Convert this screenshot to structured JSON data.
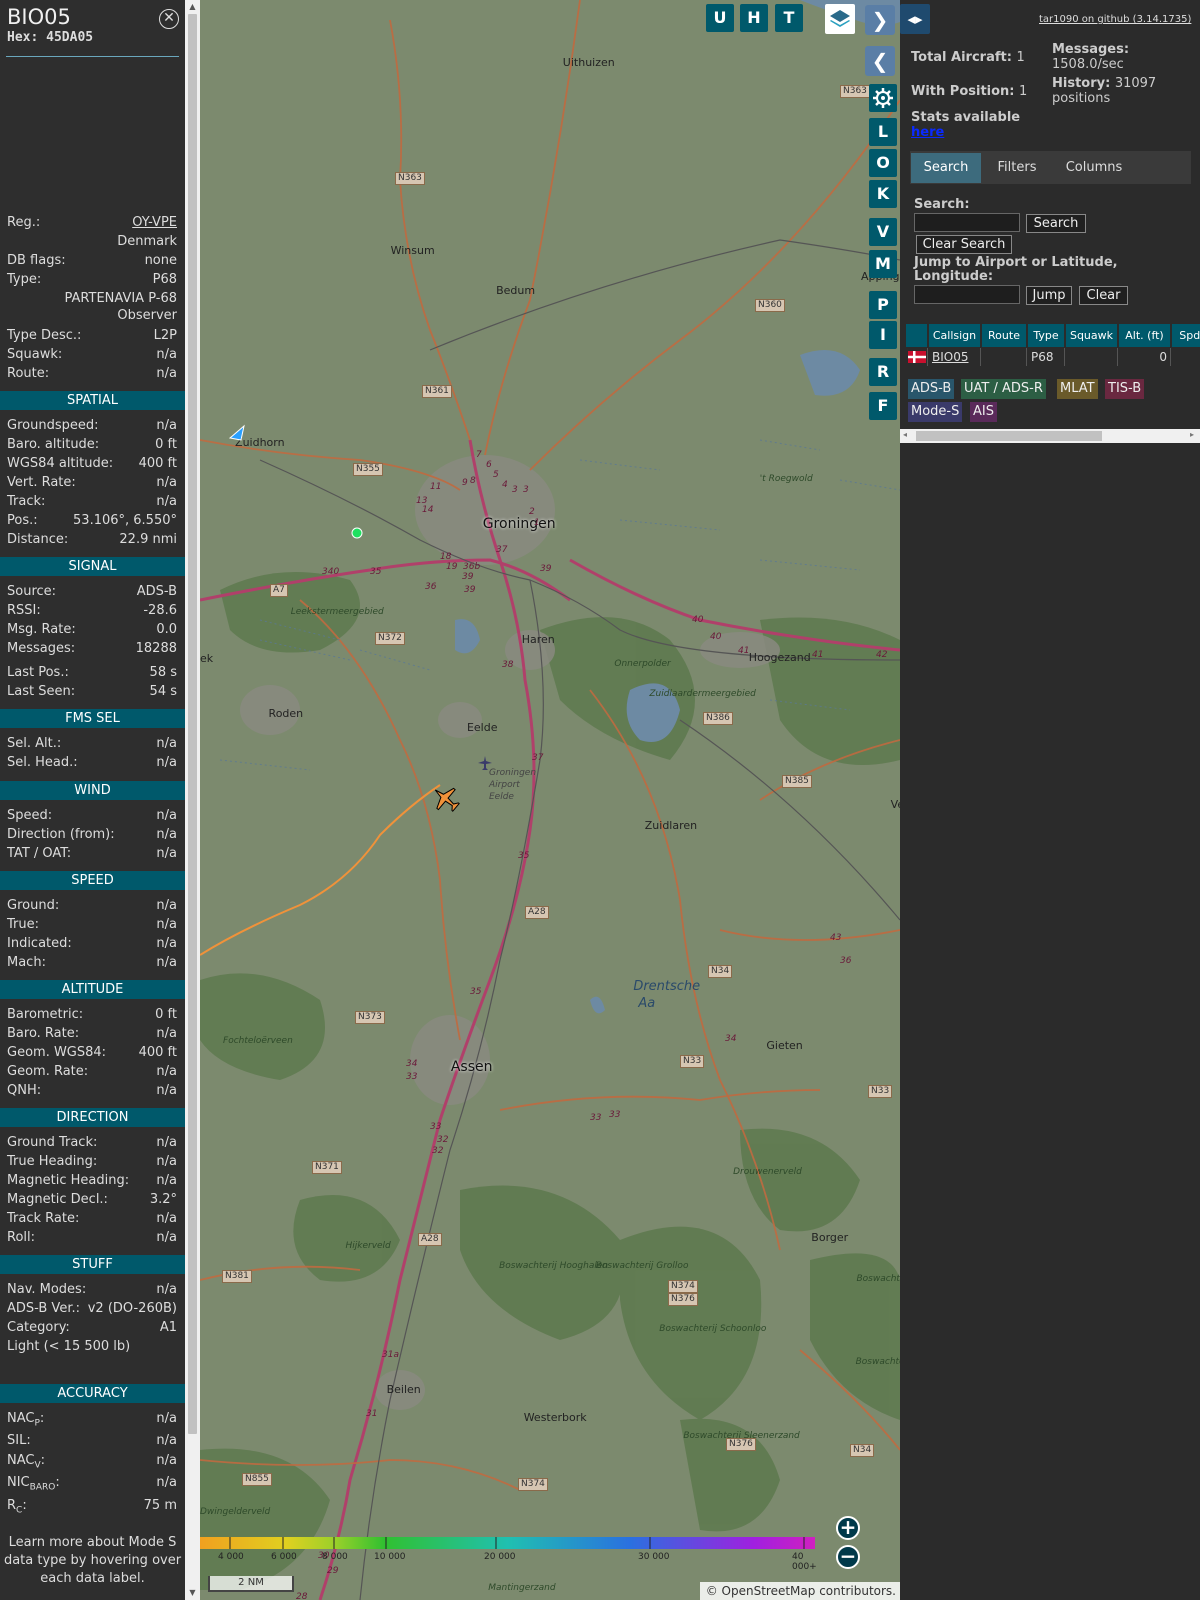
{
  "infoblock": {
    "callsign": "BIO05",
    "hex_label": "Hex:",
    "hex": "45DA05",
    "close_icon": "close-circle-icon",
    "rows_top": [
      {
        "k": "Reg.:",
        "v": "OY-VPE",
        "link": true
      },
      {
        "k": "",
        "v": "Denmark"
      },
      {
        "k": "DB flags:",
        "v": "none"
      },
      {
        "k": "Type:",
        "v": "P68"
      },
      {
        "k": "",
        "v": "PARTENAVIA P-68 Observer"
      },
      {
        "k": "Type Desc.:",
        "v": "L2P"
      },
      {
        "k": "Squawk:",
        "v": "n/a"
      },
      {
        "k": "Route:",
        "v": "n/a"
      }
    ],
    "spatial": {
      "title": "SPATIAL",
      "rows": [
        {
          "k": "Groundspeed:",
          "v": "n/a"
        },
        {
          "k": "Baro. altitude:",
          "v": "0 ft"
        },
        {
          "k": "WGS84 altitude:",
          "v": "400 ft"
        },
        {
          "k": "Vert. Rate:",
          "v": "n/a"
        },
        {
          "k": "Track:",
          "v": "n/a"
        },
        {
          "k": "Pos.:",
          "v": "53.106°, 6.550°"
        },
        {
          "k": "Distance:",
          "v": "22.9 nmi"
        }
      ]
    },
    "signal": {
      "title": "SIGNAL",
      "rows": [
        {
          "k": "Source:",
          "v": "ADS-B"
        },
        {
          "k": "RSSI:",
          "v": "-28.6"
        },
        {
          "k": "Msg. Rate:",
          "v": "0.0"
        },
        {
          "k": "Messages:",
          "v": "18288"
        },
        {
          "k": "Last Pos.:",
          "v": "58 s"
        },
        {
          "k": "Last Seen:",
          "v": "54 s"
        }
      ]
    },
    "fms": {
      "title": "FMS SEL",
      "rows": [
        {
          "k": "Sel. Alt.:",
          "v": "n/a"
        },
        {
          "k": "Sel. Head.:",
          "v": "n/a"
        }
      ]
    },
    "wind": {
      "title": "WIND",
      "rows": [
        {
          "k": "Speed:",
          "v": "n/a"
        },
        {
          "k": "Direction (from):",
          "v": "n/a"
        },
        {
          "k": "TAT / OAT:",
          "v": "n/a"
        }
      ]
    },
    "speed": {
      "title": "SPEED",
      "rows": [
        {
          "k": "Ground:",
          "v": "n/a"
        },
        {
          "k": "True:",
          "v": "n/a"
        },
        {
          "k": "Indicated:",
          "v": "n/a"
        },
        {
          "k": "Mach:",
          "v": "n/a"
        }
      ]
    },
    "altitude": {
      "title": "ALTITUDE",
      "rows": [
        {
          "k": "Barometric:",
          "v": "0 ft"
        },
        {
          "k": "Baro. Rate:",
          "v": "n/a"
        },
        {
          "k": "Geom. WGS84:",
          "v": "400 ft"
        },
        {
          "k": "Geom. Rate:",
          "v": "n/a"
        },
        {
          "k": "QNH:",
          "v": "n/a"
        }
      ]
    },
    "direction": {
      "title": "DIRECTION",
      "rows": [
        {
          "k": "Ground Track:",
          "v": "n/a"
        },
        {
          "k": "True Heading:",
          "v": "n/a"
        },
        {
          "k": "Magnetic Heading:",
          "v": "n/a"
        },
        {
          "k": "Magnetic Decl.:",
          "v": "3.2°"
        },
        {
          "k": "Track Rate:",
          "v": "n/a"
        },
        {
          "k": "Roll:",
          "v": "n/a"
        }
      ]
    },
    "stuff": {
      "title": "STUFF",
      "rows": [
        {
          "k": "Nav. Modes:",
          "v": "n/a"
        },
        {
          "k": "ADS-B Ver.:",
          "v": "v2 (DO-260B)"
        },
        {
          "k": "Category:",
          "v": "A1"
        },
        {
          "k": "Light (< 15 500 lb)",
          "v": ""
        }
      ]
    },
    "accuracy": {
      "title": "ACCURACY",
      "rows": [
        {
          "k": "NAC",
          "sub": "P",
          "v": "n/a"
        },
        {
          "k": "SIL:",
          "sub": "",
          "v": "n/a"
        },
        {
          "k": "NAC",
          "sub": "V",
          "v": "n/a"
        },
        {
          "k": "NIC",
          "sub": "BARO",
          "v": "n/a"
        },
        {
          "k": "R",
          "sub": "C",
          "v": "75 m"
        }
      ]
    },
    "footer": "Learn more about Mode S data type by hovering over each data label."
  },
  "map": {
    "buttons_top": [
      "U",
      "H",
      "T"
    ],
    "layers_icon": "layers-icon",
    "nav_next_icon": "chevron-right-icon",
    "nav_prev_icon": "chevron-left-icon",
    "expand_icon": "expand-horizontal-icon",
    "settings_icon": "gear-icon",
    "side_buttons": [
      "L",
      "O",
      "K",
      "V",
      "M",
      "P",
      "I",
      "R",
      "F"
    ],
    "zoom_in": "+",
    "zoom_out": "−",
    "scale": "2 NM",
    "attribution_prefix": "©",
    "attribution_link": "OpenStreetMap",
    "attribution_suffix": " contributors.",
    "altitude_legend": [
      "4 000",
      "6 000",
      "8 000",
      "10 000",
      "20 000",
      "30 000",
      "40 000+"
    ],
    "places": [
      {
        "name": "Uithuizen",
        "cls": "town"
      },
      {
        "name": "Winsum",
        "cls": "town"
      },
      {
        "name": "Bedum",
        "cls": "town"
      },
      {
        "name": "Zuidhorn",
        "cls": "town"
      },
      {
        "name": "Groningen",
        "cls": "city"
      },
      {
        "name": "Haren",
        "cls": "town"
      },
      {
        "name": "Hoogezand",
        "cls": "town"
      },
      {
        "name": "Roden",
        "cls": "town"
      },
      {
        "name": "Eelde",
        "cls": "town"
      },
      {
        "name": "Zuidlaren",
        "cls": "town"
      },
      {
        "name": "Assen",
        "cls": "city"
      },
      {
        "name": "Gieten",
        "cls": "town"
      },
      {
        "name": "Borger",
        "cls": "town"
      },
      {
        "name": "Beilen",
        "cls": "town"
      },
      {
        "name": "Westerbork",
        "cls": "town"
      },
      {
        "name": "Drentsche",
        "cls": "water"
      },
      {
        "name": "Aa",
        "cls": "water"
      },
      {
        "name": "Groningen",
        "cls": "small"
      },
      {
        "name": "Airport",
        "cls": "small"
      },
      {
        "name": "Eelde",
        "cls": "small"
      },
      {
        "name": "Leekstermeergebied",
        "cls": "park"
      },
      {
        "name": "Onnerpolder",
        "cls": "park"
      },
      {
        "name": "Zuidlaardermeergebied",
        "cls": "park"
      },
      {
        "name": "Fochteloërveen",
        "cls": "park"
      },
      {
        "name": "Drouwenerveld",
        "cls": "park"
      },
      {
        "name": "Hijkerveld",
        "cls": "park"
      },
      {
        "name": "Boswachterij Hooghalen",
        "cls": "park"
      },
      {
        "name": "Boswachterij Grolloo",
        "cls": "park"
      },
      {
        "name": "Boswachterij Schoonloo",
        "cls": "park"
      },
      {
        "name": "Boswachterij Exloo",
        "cls": "park"
      },
      {
        "name": "Boswachterij Odoorn",
        "cls": "park"
      },
      {
        "name": "Boswachterij Sleenerzand",
        "cls": "park"
      },
      {
        "name": "Dwingelderveld",
        "cls": "park"
      },
      {
        "name": "Mantingerzand",
        "cls": "park"
      },
      {
        "name": "'t Roegwold",
        "cls": "park"
      },
      {
        "name": "ek",
        "cls": "town"
      },
      {
        "name": "Appingedam",
        "cls": "town"
      },
      {
        "name": "Ve",
        "cls": "town"
      }
    ],
    "roads": [
      "N363",
      "N363",
      "N360",
      "N361",
      "N355",
      "A7",
      "N372",
      "N386",
      "N385",
      "A28",
      "N34",
      "N373",
      "N33",
      "N371",
      "A28",
      "N381",
      "N374",
      "N376",
      "N376",
      "N34",
      "N855",
      "N374",
      "N33"
    ],
    "road_numbers": [
      "7",
      "6",
      "5",
      "4",
      "3",
      "3",
      "2",
      "1",
      "11",
      "9",
      "8",
      "13",
      "14",
      "36b",
      "18",
      "19",
      "37",
      "39",
      "39",
      "39",
      "35",
      "36",
      "340",
      "38",
      "37",
      "35",
      "40",
      "40",
      "41",
      "41",
      "42",
      "43",
      "36",
      "35",
      "34",
      "33",
      "33",
      "33",
      "32",
      "32",
      "31a",
      "31",
      "30",
      "29",
      "28",
      "34",
      "33"
    ]
  },
  "right": {
    "github": "tar1090 on github (3.14.1735)",
    "total_aircraft_label": "Total Aircraft:",
    "total_aircraft": "1",
    "with_position_label": "With Position:",
    "with_position": "1",
    "messages_label": "Messages:",
    "messages": "1508.0/sec",
    "history_label": "History:",
    "history": "31097 positions",
    "stats_label": "Stats available",
    "stats_link": "here",
    "tabs": [
      "Search",
      "Filters",
      "Columns"
    ],
    "search_label": "Search:",
    "search_button": "Search",
    "clear_search_button": "Clear Search",
    "jump_label": "Jump to Airport or Latitude, Longitude:",
    "jump_button": "Jump",
    "clear_button": "Clear",
    "columns": [
      "",
      "Callsign",
      "Route",
      "Type",
      "Squawk",
      "Alt. (ft)",
      "Spd."
    ],
    "rows": [
      {
        "flag_icon": "flag-denmark-icon",
        "callsign": "BIO05",
        "route": "",
        "type": "P68",
        "squawk": "",
        "alt": "0",
        "spd": ""
      }
    ],
    "badges": [
      {
        "label": "ADS-B",
        "color": "#29566b"
      },
      {
        "label": "UAT / ADS-R",
        "color": "#2c5e44"
      },
      {
        "label": "MLAT",
        "color": "#6a5a2a"
      },
      {
        "label": "TIS-B",
        "color": "#6a2840"
      },
      {
        "label": "Mode-S",
        "color": "#3a3a6a"
      },
      {
        "label": "AIS",
        "color": "#5a2a5a"
      }
    ]
  }
}
